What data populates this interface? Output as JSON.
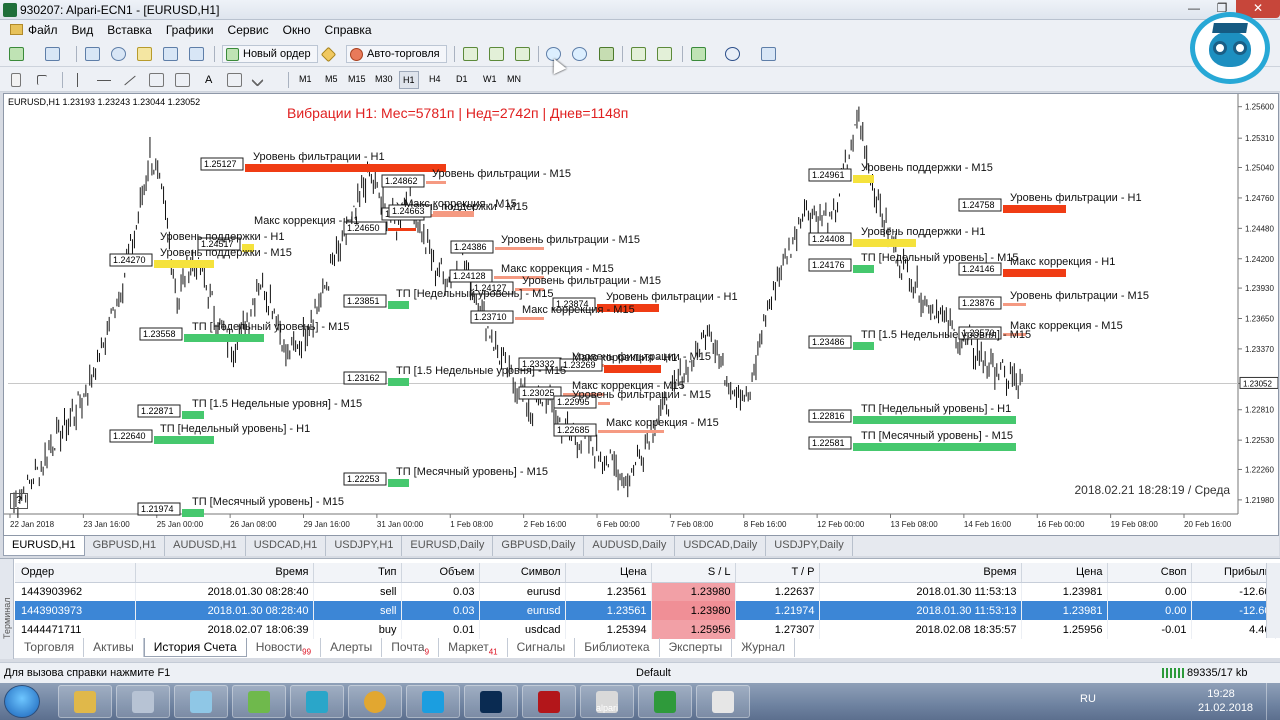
{
  "window": {
    "title": "930207: Alpari-ECN1 - [EURUSD,H1]",
    "controls": [
      "—",
      "❐",
      "✕"
    ]
  },
  "menu": [
    "Файл",
    "Вид",
    "Вставка",
    "Графики",
    "Сервис",
    "Окно",
    "Справка"
  ],
  "toolbar": {
    "new_order": "Новый ордер",
    "auto_trading": "Авто-торговля"
  },
  "timeframes": {
    "items": [
      "M1",
      "M5",
      "M15",
      "M30",
      "H1",
      "H4",
      "D1",
      "W1",
      "MN"
    ],
    "active": "H1"
  },
  "chart": {
    "info": "EURUSD,H1  1.23193 1.23243 1.23044 1.23052",
    "title": "Вибрации H1: Мес=5781п | Нед=2742п | Днев=1148п",
    "datetime": "2018.02.21 18:28:19 / Среда",
    "help": "?",
    "colors": {
      "red": "#f03c14",
      "salmon": "#f59a82",
      "green": "#46c86e",
      "yellow": "#f5e23c",
      "title": "#e02020"
    }
  },
  "chart_data": {
    "type": "line",
    "symbol": "EURUSD",
    "timeframe": "H1",
    "ylim": [
      1.2185,
      1.2568
    ],
    "y_ticks": [
      "1.25600",
      "1.25310",
      "1.25040",
      "1.24760",
      "1.24480",
      "1.24200",
      "1.23930",
      "1.23650",
      "1.23370",
      "1.23052",
      "1.22810",
      "1.22530",
      "1.22260",
      "1.21980"
    ],
    "current_price": "1.23052",
    "x_ticks": [
      "22 Jan 2018",
      "23 Jan 16:00",
      "25 Jan 00:00",
      "26 Jan 08:00",
      "29 Jan 16:00",
      "31 Jan 00:00",
      "1 Feb 08:00",
      "2 Feb 16:00",
      "6 Feb 00:00",
      "7 Feb 08:00",
      "8 Feb 16:00",
      "12 Feb 00:00",
      "13 Feb 08:00",
      "14 Feb 16:00",
      "16 Feb 00:00",
      "19 Feb 08:00",
      "20 Feb 16:00"
    ],
    "price_path": [
      1.2195,
      1.221,
      1.223,
      1.2255,
      1.227,
      1.229,
      1.232,
      1.236,
      1.24,
      1.245,
      1.252,
      1.247,
      1.238,
      1.242,
      1.24,
      1.236,
      1.234,
      1.236,
      1.24,
      1.238,
      1.233,
      1.2345,
      1.237,
      1.24,
      1.243,
      1.246,
      1.25,
      1.247,
      1.245,
      1.248,
      1.244,
      1.241,
      1.24,
      1.242,
      1.238,
      1.235,
      1.232,
      1.23,
      1.228,
      1.2295,
      1.227,
      1.226,
      1.225,
      1.224,
      1.223,
      1.2215,
      1.224,
      1.227,
      1.229,
      1.231,
      1.233,
      1.236,
      1.232,
      1.23,
      1.229,
      1.236,
      1.24,
      1.243,
      1.247,
      1.246,
      1.245,
      1.25,
      1.255,
      1.249,
      1.245,
      1.242,
      1.24,
      1.238,
      1.237,
      1.235,
      1.234,
      1.233,
      1.232,
      1.231,
      1.2305
    ],
    "levels": [
      {
        "label": "Уровень фильтрации - H1",
        "box": "1.25127",
        "color": "red"
      },
      {
        "label": "Уровень фильтрации - M15",
        "box": "1.24862",
        "color": "salmon"
      },
      {
        "label": "Уровень поддержки - M15",
        "box": "1.24627",
        "color": "salmon"
      },
      {
        "label": "Макс коррекция - H1",
        "box": "1.24650",
        "color": "red"
      },
      {
        "label": "Макс коррекция - M15",
        "box": "1.24663",
        "color": "salmon"
      },
      {
        "label": "Уровень поддержки - H1",
        "box": "1.24517",
        "color": "yellow"
      },
      {
        "label": "Уровень поддержки - M15",
        "box": "1.24270",
        "color": "yellow"
      },
      {
        "label": "Уровень фильтрации - M15",
        "box": "1.24386",
        "color": "salmon"
      },
      {
        "label": "Макс коррекция - M15",
        "box": "1.24128",
        "color": "salmon"
      },
      {
        "label": "Уровень фильтрации - M15",
        "box": "1.24127",
        "color": "salmon"
      },
      {
        "label": "ТП [Недельный уровень] - M15",
        "box": "1.23851",
        "color": "green"
      },
      {
        "label": "Уровень фильтрации - H1",
        "box": "1.23874",
        "color": "red"
      },
      {
        "label": "Макс коррекция - M15",
        "box": "1.23710",
        "color": "salmon"
      },
      {
        "label": "ТП [Недельный уровень] - M15",
        "box": "1.23558",
        "color": "green"
      },
      {
        "label": "Уровень фильтрации - M15",
        "box": "1.23332",
        "color": "salmon"
      },
      {
        "label": "Макс коррекция - H1",
        "box": "1.23269",
        "color": "red"
      },
      {
        "label": "ТП [1.5 Недельные уровня] - M15",
        "box": "1.23162",
        "color": "green"
      },
      {
        "label": "Макс коррекция - M15",
        "box": "1.23025",
        "color": "salmon"
      },
      {
        "label": "Уровень фильтрации - M15",
        "box": "1.22995",
        "color": "salmon"
      },
      {
        "label": "ТП [1.5 Недельные уровня] - M15",
        "box": "1.22871",
        "color": "green"
      },
      {
        "label": "Макс коррекция - M15",
        "box": "1.22685",
        "color": "salmon"
      },
      {
        "label": "ТП [Недельный уровень] - H1",
        "box": "1.22640",
        "color": "green"
      },
      {
        "label": "ТП [Месячный уровень] - M15",
        "box": "1.22253",
        "color": "green"
      },
      {
        "label": "ТП [Месячный уровень] - M15",
        "box": "1.21974",
        "color": "green"
      },
      {
        "label": "Уровень поддержки - M15",
        "box": "1.24961",
        "color": "yellow"
      },
      {
        "label": "Уровень фильтрации - H1",
        "box": "1.24758",
        "color": "red"
      },
      {
        "label": "Уровень поддержки - H1",
        "box": "1.24408",
        "color": "yellow"
      },
      {
        "label": "ТП [Недельный уровень] - M15",
        "box": "1.24176",
        "color": "green"
      },
      {
        "label": "Макс коррекция - H1",
        "box": "1.24146",
        "color": "red"
      },
      {
        "label": "Уровень фильтрации - M15",
        "box": "1.23876",
        "color": "salmon"
      },
      {
        "label": "Макс коррекция - M15",
        "box": "1.23570",
        "color": "salmon"
      },
      {
        "label": "ТП [1.5 Недельные уровня] - M15",
        "box": "1.23486",
        "color": "green"
      },
      {
        "label": "ТП [Недельный уровень] - H1",
        "box": "1.22816",
        "color": "green"
      },
      {
        "label": "ТП [Месячный уровень] - M15",
        "box": "1.22581",
        "color": "green"
      }
    ]
  },
  "symbol_tabs": [
    "EURUSD,H1",
    "GBPUSD,H1",
    "AUDUSD,H1",
    "USDCAD,H1",
    "USDJPY,H1",
    "EURUSD,Daily",
    "GBPUSD,Daily",
    "AUDUSD,Daily",
    "USDCAD,Daily",
    "USDJPY,Daily"
  ],
  "terminal": {
    "side_label": "Терминал",
    "columns": [
      "Ордер",
      "Время",
      "Тип",
      "Объем",
      "Символ",
      "Цена",
      "S / L",
      "T / P",
      "Время",
      "Цена",
      "Своп",
      "Прибыль"
    ],
    "rows": [
      [
        "1443903962",
        "2018.01.30 08:28:40",
        "sell",
        "0.03",
        "eurusd",
        "1.23561",
        "1.23980",
        "1.22637",
        "2018.01.30 11:53:13",
        "1.23981",
        "0.00",
        "-12.60"
      ],
      [
        "1443903973",
        "2018.01.30 08:28:40",
        "sell",
        "0.03",
        "eurusd",
        "1.23561",
        "1.23980",
        "1.21974",
        "2018.01.30 11:53:13",
        "1.23981",
        "0.00",
        "-12.60"
      ],
      [
        "1444471711",
        "2018.02.07 18:06:39",
        "buy",
        "0.01",
        "usdcad",
        "1.25394",
        "1.25956",
        "1.27307",
        "2018.02.08 18:35:57",
        "1.25956",
        "-0.01",
        "4.46"
      ]
    ],
    "selected_row": 1,
    "tabs": [
      {
        "label": "Торговля",
        "badge": ""
      },
      {
        "label": "Активы",
        "badge": ""
      },
      {
        "label": "История Счета",
        "badge": ""
      },
      {
        "label": "Новости",
        "badge": "99"
      },
      {
        "label": "Алерты",
        "badge": ""
      },
      {
        "label": "Почта",
        "badge": "9"
      },
      {
        "label": "Маркет",
        "badge": "41"
      },
      {
        "label": "Сигналы",
        "badge": ""
      },
      {
        "label": "Библиотека",
        "badge": ""
      },
      {
        "label": "Эксперты",
        "badge": ""
      },
      {
        "label": "Журнал",
        "badge": ""
      }
    ],
    "active_tab": "История Счета"
  },
  "status": {
    "help": "Для вызова справки нажмите F1",
    "profile": "Default",
    "connection": "89335/17 kb"
  },
  "taskbar": {
    "apps": [
      "file-manager",
      "calculator",
      "notes",
      "chart-app",
      "phone",
      "chrome",
      "skype",
      "photoshop",
      "filezilla",
      "alpari",
      "camtasia-green",
      "camtasia-white"
    ],
    "alpari_label": "alpari",
    "lang": "RU",
    "time": "19:28",
    "date": "21.02.2018"
  }
}
